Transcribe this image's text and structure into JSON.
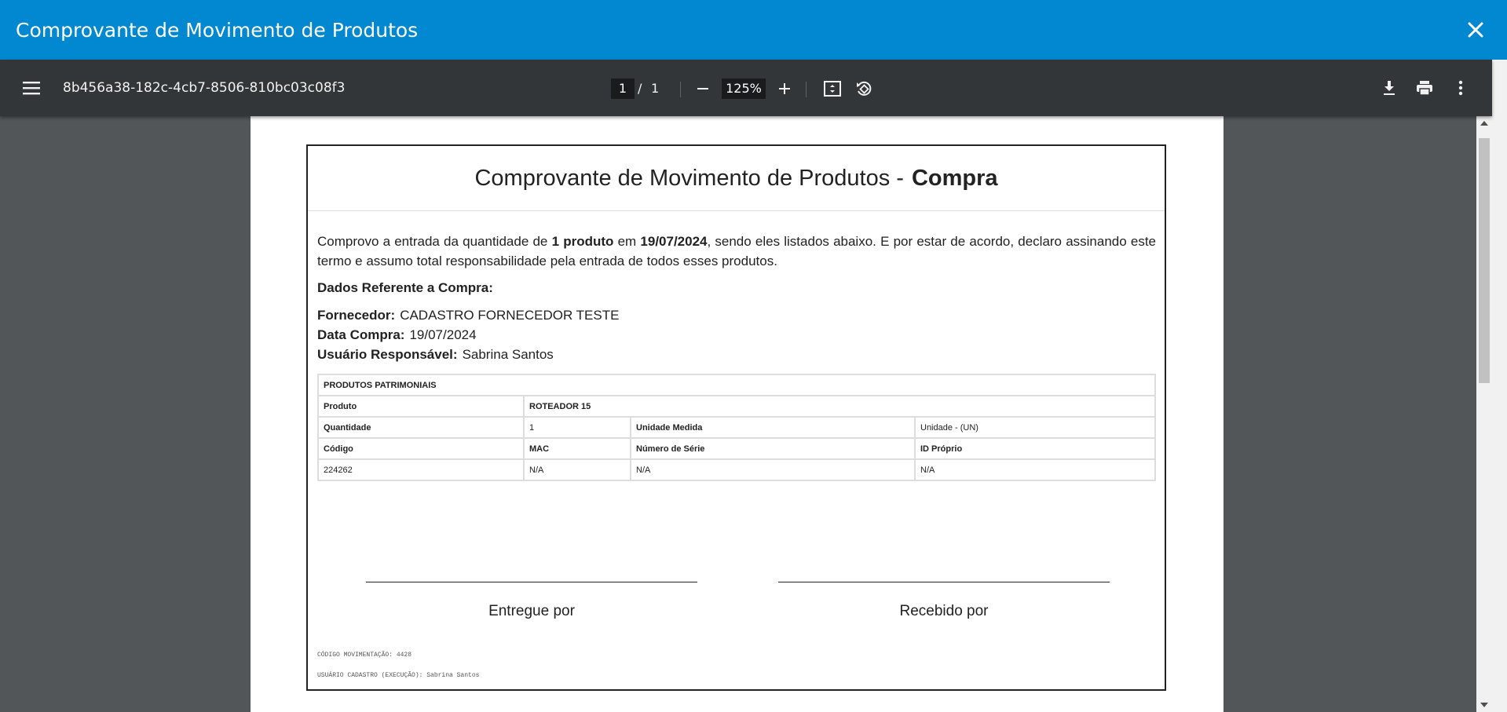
{
  "modal": {
    "title": "Comprovante de Movimento de Produtos",
    "close_icon": "close-icon",
    "header_color": "#0288d1"
  },
  "toolbar": {
    "menu_icon": "menu-icon",
    "filename": "8b456a38-182c-4cb7-8506-810bc03c08f3",
    "current_page": "1",
    "page_separator": "/",
    "total_pages": "1",
    "zoom_out_icon": "minus-icon",
    "zoom": "125%",
    "zoom_in_icon": "plus-icon",
    "fit_icon": "fit-page-icon",
    "rotate_icon": "rotate-icon",
    "download_icon": "download-icon",
    "print_icon": "print-icon",
    "more_icon": "more-vert-icon"
  },
  "document": {
    "title_prefix": "Comprovante de Movimento de Produtos -",
    "title_bold": "Compra",
    "para_1": "Comprovo a entrada da quantidade de",
    "para_qty": "1 produto",
    "para_2": "em",
    "para_date": "19/07/2024",
    "para_3": ", sendo eles listados abaixo. E por estar de acordo, declaro assinando este termo e assumo total responsabilidade pela entrada de todos esses produtos.",
    "section_heading": "Dados Referente a Compra:",
    "fornecedor_label": "Fornecedor:",
    "fornecedor_value": "CADASTRO FORNECEDOR TESTE",
    "data_label": "Data Compra:",
    "data_value": "19/07/2024",
    "usuario_label": "Usuário Responsável:",
    "usuario_value": "Sabrina Santos",
    "table": {
      "header": "PRODUTOS PATRIMONIAIS",
      "produto_label": "Produto",
      "produto_value": "ROTEADOR 15",
      "quantidade_label": "Quantidade",
      "quantidade_value": "1",
      "unidade_label": "Unidade Medida",
      "unidade_value": "Unidade - (UN)",
      "codigo_label": "Código",
      "mac_label": "MAC",
      "serie_label": "Número de Série",
      "idproprio_label": "ID Próprio",
      "codigo_value": "224262",
      "mac_value": "N/A",
      "serie_value": "N/A",
      "idproprio_value": "N/A"
    },
    "sig_left": "Entregue por",
    "sig_right": "Recebido por",
    "footer_1": "CÓDIGO MOVIMENTAÇÃO: 4428",
    "footer_2": "USUÁRIO CADASTRO (EXECUÇÃO): Sabrina Santos"
  }
}
